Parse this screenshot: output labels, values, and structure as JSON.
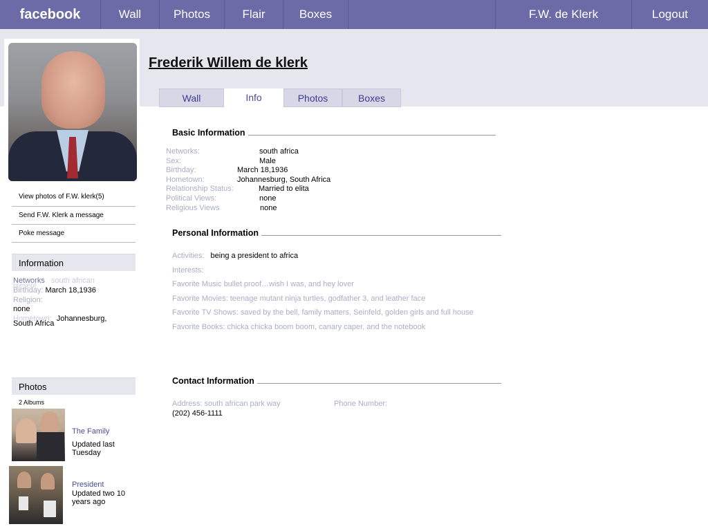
{
  "nav": {
    "logo": "facebook",
    "items": [
      "Wall",
      "Photos",
      "Flair",
      "Boxes"
    ],
    "user": "F.W. de Klerk",
    "logout": "Logout"
  },
  "profile": {
    "name": "Frederik Willem de klerk"
  },
  "left_links": [
    "View photos of F.W. klerk(5)",
    "Send F.W. Klerk a message",
    "Poke message"
  ],
  "info_box": {
    "title": "Information",
    "networks_label": "Networks",
    "networks_value": "south african",
    "present": "present",
    "birthday_label": "Birthday:",
    "birthday_value": "March 18,1936",
    "religion_label": "Religion:",
    "religion_value": "none",
    "hometown_label": "Hometown:",
    "hometown_value": "Johannesburg,",
    "hometown_value2": "South  Africa"
  },
  "photos_box": {
    "title": "Photos",
    "count": "2 Albums",
    "albums": [
      {
        "title": "The Family",
        "updated": "Updated last Tuesday"
      },
      {
        "title": "President",
        "updated": "Updated two 10 years ago"
      }
    ]
  },
  "tabs": [
    "Wall",
    "Info",
    "Photos",
    "Boxes"
  ],
  "active_tab": "Info",
  "basic_info": {
    "title": "Basic Information",
    "rows": [
      {
        "label": "Networks:",
        "value": "south africa"
      },
      {
        "label": "Sex:",
        "value": "Male"
      },
      {
        "label": "Birthday:",
        "value": "March 18,1936"
      },
      {
        "label": "Hometown:",
        "value": "Johannesburg, South  Africa"
      },
      {
        "label": "Relationship Status:",
        "value": "Married to elita"
      },
      {
        "label": "Political Views:",
        "value": "none"
      },
      {
        "label": "Religious Views",
        "value": "none"
      }
    ]
  },
  "personal_info": {
    "title": "Personal Information",
    "activities_label": "Activities:",
    "activities_value": "being a president  to africa",
    "interests_label": "Interests:",
    "music": "Favorite Music bullet proof…wish I was, and hey lover",
    "movies": "Favorite Movies: teenage mutant ninja turtles, godfather 3, and leather face",
    "tv": "Favorite TV Shows: saved by the bell, family matters, Seinfeld, golden girls and full house",
    "books": "Favorite Books: chicka chicka boom boom, canary caper, and  the notebook"
  },
  "contact_info": {
    "title": "Contact Information",
    "address": "Address: south african park way",
    "phone_label": "Phone Number:",
    "phone_value": "(202) 456-1111"
  },
  "colors": {
    "nav_bg": "#6d6aa8",
    "header_band": "#e6e6ee",
    "label": "#a9aec6",
    "link": "#4b4b98"
  }
}
